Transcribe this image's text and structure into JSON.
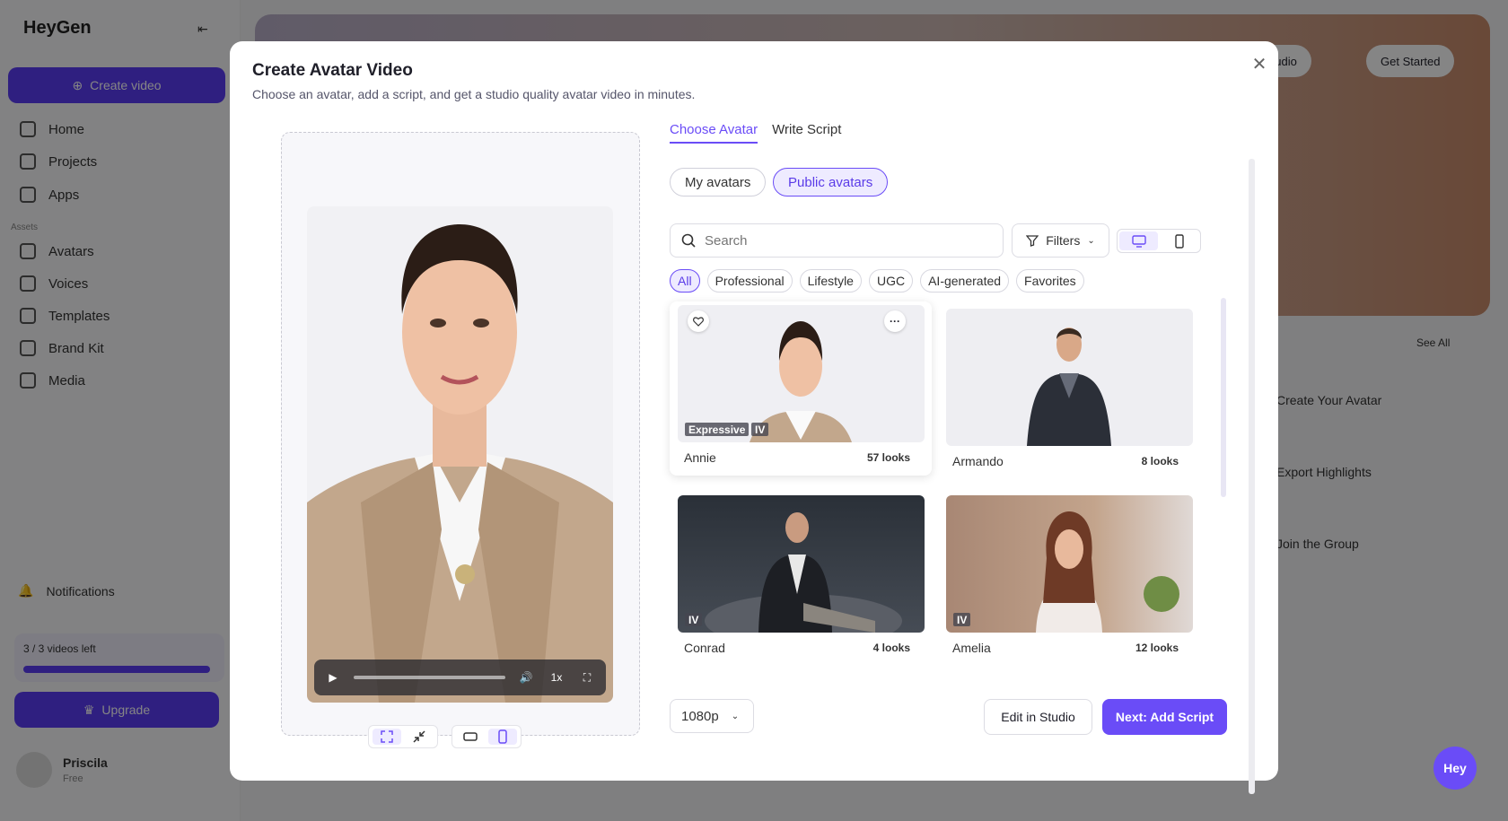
{
  "app": {
    "logo": "HeyGen"
  },
  "sidebar": {
    "create_label": "Create video",
    "section_label": "Assets",
    "items": [
      {
        "label": "Home"
      },
      {
        "label": "Projects"
      },
      {
        "label": "Apps"
      },
      {
        "label": "Avatars"
      },
      {
        "label": "Voices"
      },
      {
        "label": "Templates"
      },
      {
        "label": "Brand Kit"
      },
      {
        "label": "Media"
      }
    ],
    "notifications_label": "Notifications",
    "plan_text": "3 / 3 videos left",
    "upgrade_label": "Upgrade",
    "user_name": "Priscila",
    "user_plan": "Free"
  },
  "background": {
    "header_btn_1": "Studio",
    "header_btn_2": "Get Started",
    "see_all": "See All",
    "right_items": [
      "Create Your Avatar",
      "Export Highlights",
      "Join the Group"
    ]
  },
  "modal": {
    "title": "Create Avatar Video",
    "subtitle": "Choose an avatar, add a script, and get a studio quality avatar video in minutes.",
    "tabs": [
      "Choose Avatar",
      "Write Script"
    ],
    "segments": [
      "My avatars",
      "Public avatars"
    ],
    "search_placeholder": "Search",
    "filters_label": "Filters",
    "chips": [
      "All",
      "Professional",
      "Lifestyle",
      "UGC",
      "AI-generated",
      "Favorites"
    ],
    "cards": [
      {
        "name": "Annie",
        "looks": "57 looks",
        "badges": [
          "Expressive",
          "IV"
        ]
      },
      {
        "name": "Armando",
        "looks": "8 looks",
        "badges": []
      },
      {
        "name": "Conrad",
        "looks": "4 looks",
        "badges": [
          "IV"
        ]
      },
      {
        "name": "Amelia",
        "looks": "12 looks",
        "badges": [
          "IV"
        ]
      }
    ],
    "player": {
      "speed": "1x"
    },
    "resolution": "1080p",
    "edit_studio_label": "Edit in Studio",
    "next_label": "Next: Add Script"
  },
  "hey_label": "Hey",
  "colors": {
    "accent": "#6a4cf7",
    "accent_light": "#eeebff"
  }
}
